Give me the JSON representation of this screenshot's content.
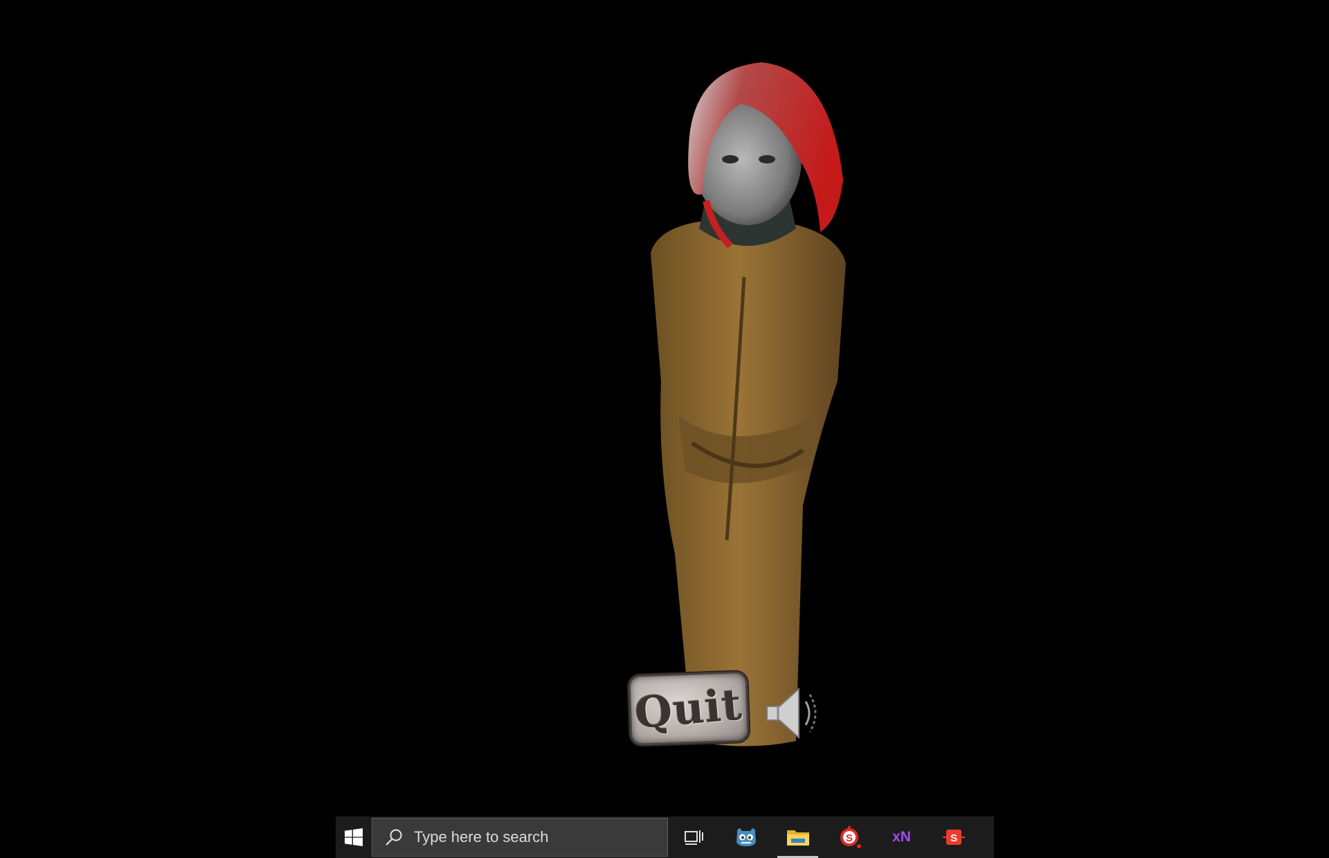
{
  "game": {
    "quit_label": "Quit",
    "speaker_icon": "speaker-icon"
  },
  "taskbar": {
    "start_icon": "windows-logo-icon",
    "search_placeholder": "Type here to search",
    "apps": [
      {
        "name": "task-view",
        "icon": "task-view-icon"
      },
      {
        "name": "godot",
        "icon": "godot-icon"
      },
      {
        "name": "file-explorer",
        "icon": "folder-icon",
        "active": true
      },
      {
        "name": "substance",
        "icon": "substance-painter-icon"
      },
      {
        "name": "xnormal",
        "icon": "xnormal-icon",
        "label": "xN"
      },
      {
        "name": "substance-alt",
        "icon": "substance-designer-icon"
      }
    ]
  }
}
